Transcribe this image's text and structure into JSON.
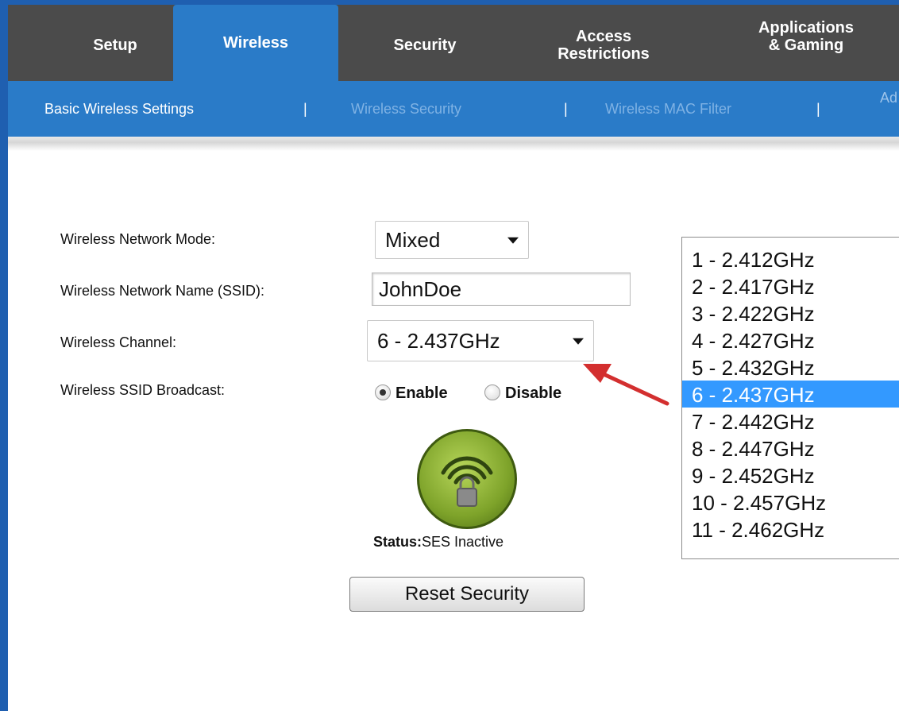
{
  "tabs": [
    {
      "label": "Setup",
      "active": false
    },
    {
      "label": "Wireless",
      "active": true
    },
    {
      "label": "Security",
      "active": false
    },
    {
      "label": "Access\nRestrictions",
      "active": false
    },
    {
      "label": "Applications\n& Gaming",
      "active": false
    }
  ],
  "subnav": {
    "items": [
      {
        "label": "Basic Wireless Settings",
        "active": true
      },
      {
        "label": "Wireless Security",
        "active": false
      },
      {
        "label": "Wireless MAC Filter",
        "active": false
      },
      {
        "label": "Ad",
        "active": false
      }
    ],
    "separator": "|"
  },
  "form": {
    "mode_label": "Wireless Network Mode:",
    "mode_value": "Mixed",
    "ssid_label": "Wireless Network Name (SSID):",
    "ssid_value": "JohnDoe",
    "channel_label": "Wireless Channel:",
    "channel_value": "6 - 2.437GHz",
    "broadcast_label": "Wireless SSID Broadcast:",
    "broadcast_options": [
      {
        "label": "Enable",
        "checked": true
      },
      {
        "label": "Disable",
        "checked": false
      }
    ]
  },
  "ses": {
    "status_label": "Status:",
    "status_value": "SES Inactive"
  },
  "reset_button": "Reset Security",
  "channel_list": [
    "1 - 2.412GHz",
    "2 - 2.417GHz",
    "3 - 2.422GHz",
    "4 - 2.427GHz",
    "5 - 2.432GHz",
    "6 - 2.437GHz",
    "7 - 2.442GHz",
    "8 - 2.447GHz",
    "9 - 2.452GHz",
    "10 - 2.457GHz",
    "11 - 2.462GHz"
  ],
  "channel_selected_index": 5,
  "colors": {
    "tab_bar": "#4b4b4b",
    "accent_blue": "#2a7bc8",
    "selection": "#3399ff",
    "annotation_arrow": "#d32f2f",
    "ses_green": "#7ea32a"
  }
}
